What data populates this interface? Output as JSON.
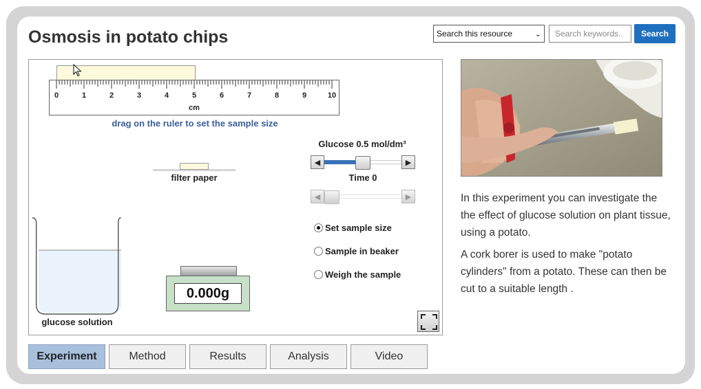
{
  "header": {
    "title": "Osmosis in potato chips",
    "search_scope": "Search this resource",
    "search_placeholder": "Search keywords..",
    "search_button": "Search"
  },
  "simulation": {
    "ruler": {
      "ticks": [
        "0",
        "1",
        "2",
        "3",
        "4",
        "5",
        "6",
        "7",
        "8",
        "9",
        "10"
      ],
      "unit": "cm",
      "hint": "drag on the ruler to set the sample size",
      "sample_length_cm": 5
    },
    "filter_paper_label": "filter paper",
    "beaker_label": "glucose solution",
    "scale_reading": "0.000g",
    "glucose_label": "Glucose 0.5 mol/dm³",
    "glucose_level": 0.5,
    "time_label": "Time 0",
    "time_level": 0,
    "options": [
      {
        "label": "Set sample size",
        "checked": true
      },
      {
        "label": "Sample in beaker",
        "checked": false
      },
      {
        "label": "Weigh the sample",
        "checked": false
      }
    ]
  },
  "tabs": [
    {
      "label": "Experiment",
      "active": true
    },
    {
      "label": "Method",
      "active": false
    },
    {
      "label": "Results",
      "active": false
    },
    {
      "label": "Analysis",
      "active": false
    },
    {
      "label": "Video",
      "active": false
    }
  ],
  "description": {
    "para1_lines": [
      "In this experiment you can investigate the",
      "the effect of glucose solution on plant tissue,",
      "using  a potato."
    ],
    "para2_lines": [
      "A cork borer is used to make \"potato",
      "cylinders\" from a potato. These can then be",
      "cut to  a suitable length ."
    ]
  },
  "colors": {
    "accent": "#1e70bf",
    "active_tab": "#a9c0dd",
    "scale_body": "#c7e0c7",
    "sample": "#fdfadd",
    "hint_text": "#3b5e9b"
  }
}
